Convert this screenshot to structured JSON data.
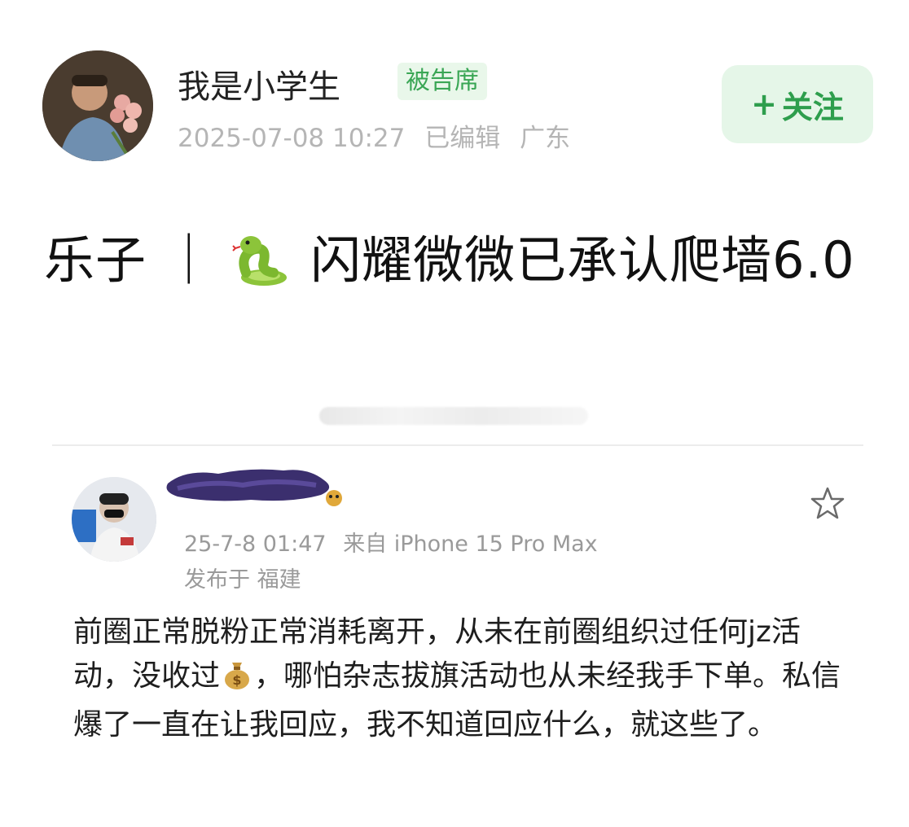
{
  "post": {
    "username": "我是小学生",
    "tag": "被告席",
    "timestamp": "2025-07-08 10:27",
    "edited": "已编辑",
    "location": "广东",
    "follow_label": "关注",
    "follow_prefix": "+",
    "title_part1": "乐子 ｜",
    "title_part2": "闪耀微微已承认爬墙6.0",
    "title_emoji": "snake-icon"
  },
  "quoted": {
    "timestamp": "25-7-8 01:47",
    "source": "来自 iPhone 15 Pro Max",
    "location": "发布于 福建",
    "body_part1": "前圈正常脱粉正常消耗离开，从未在前圈组织过任何jz活动，没收过",
    "body_emoji": "money-bag-icon",
    "body_part2": "，哪怕杂志拔旗活动也从未经我手下单。私信爆了一直在让我回应，我不知道回应什么，就这些了。"
  },
  "colors": {
    "accent_green": "#2e9e4d",
    "badge_bg": "#e9f7ea",
    "meta_grey": "#b5b5b5"
  }
}
